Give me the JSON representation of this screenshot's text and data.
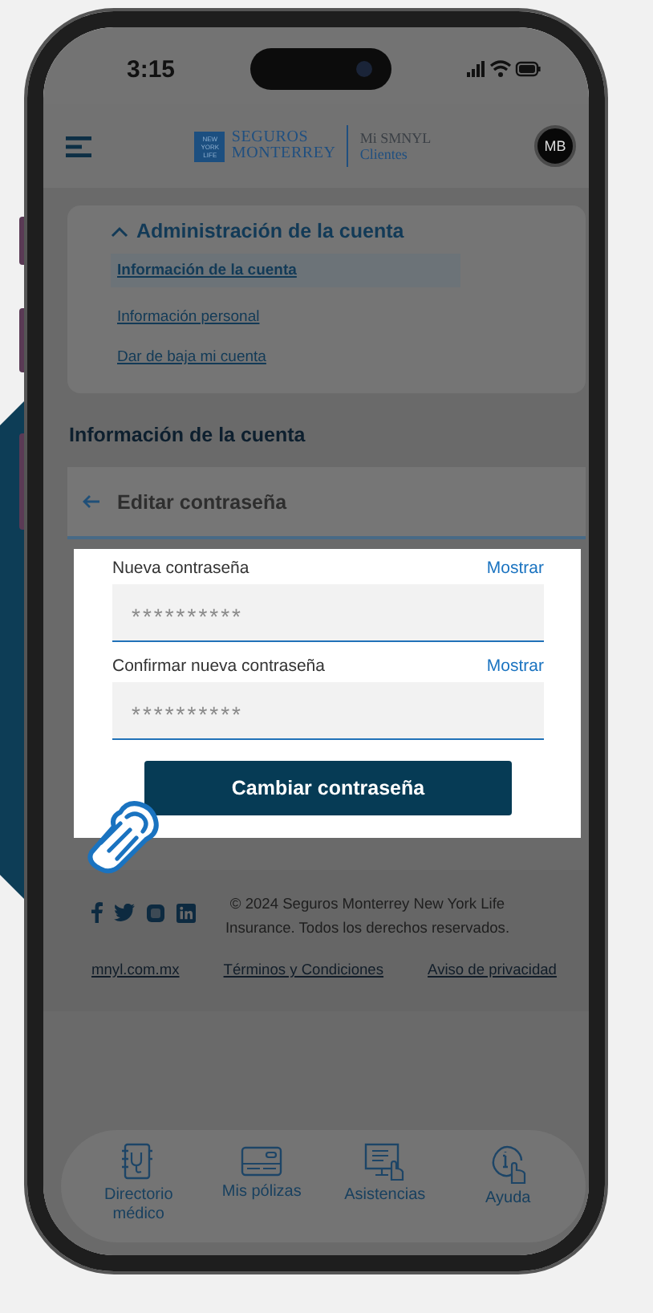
{
  "status_bar": {
    "time": "3:15"
  },
  "header": {
    "logo_mark": [
      "NEW",
      "YORK",
      "LIFE"
    ],
    "brand": [
      "SEGUROS",
      "MONTERREY"
    ],
    "app_name": [
      "Mi SMNYL",
      "Clientes"
    ],
    "avatar": "MB"
  },
  "account_menu": {
    "title": "Administración de la cuenta",
    "expanded": true,
    "items": [
      {
        "label": "Información de la cuenta",
        "selected": true
      },
      {
        "label": "Información personal",
        "selected": false
      },
      {
        "label": "Dar de baja mi cuenta",
        "selected": false
      }
    ]
  },
  "section_title": "Información de la cuenta",
  "panel": {
    "title": "Editar contraseña"
  },
  "form": {
    "fields": [
      {
        "label": "Nueva contraseña",
        "toggle": "Mostrar",
        "value": "**********"
      },
      {
        "label": "Confirmar nueva contraseña",
        "toggle": "Mostrar",
        "value": "**********"
      }
    ],
    "submit": "Cambiar contraseña"
  },
  "footer": {
    "copyright": "© 2024 Seguros Monterrey New York Life Insurance. Todos los derechos reservados.",
    "links": [
      "mnyl.com.mx",
      "Términos y Condiciones",
      "Aviso de privacidad"
    ]
  },
  "bottom_nav": [
    {
      "label": "Directorio médico",
      "kind": "directory"
    },
    {
      "label": "Mis pólizas",
      "kind": "card"
    },
    {
      "label": "Asistencias",
      "kind": "monitor"
    },
    {
      "label": "Ayuda",
      "kind": "help"
    }
  ]
}
